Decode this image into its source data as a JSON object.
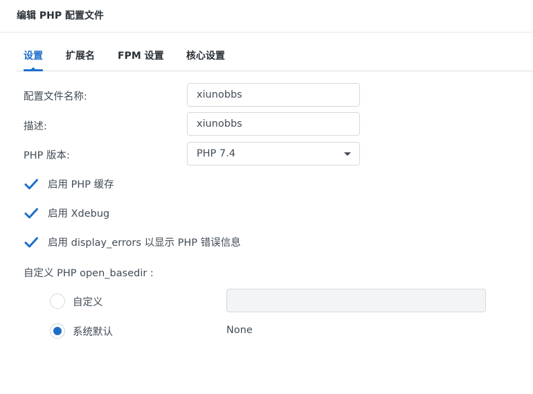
{
  "window": {
    "title": "编辑 PHP 配置文件"
  },
  "tabs": [
    {
      "label": "设置",
      "active": true
    },
    {
      "label": "扩展名",
      "active": false
    },
    {
      "label": "FPM 设置",
      "active": false
    },
    {
      "label": "核心设置",
      "active": false
    }
  ],
  "form": {
    "profile_name": {
      "label": "配置文件名称:",
      "value": "xiunobbs"
    },
    "description": {
      "label": "描述:",
      "value": "xiunobbs"
    },
    "php_version": {
      "label": "PHP 版本:",
      "value": "PHP 7.4"
    }
  },
  "checkboxes": [
    {
      "label": "启用 PHP 缓存",
      "checked": true
    },
    {
      "label": "启用 Xdebug",
      "checked": true
    },
    {
      "label": "启用 display_errors 以显示 PHP 错误信息",
      "checked": true
    }
  ],
  "open_basedir": {
    "label": "自定义 PHP open_basedir :",
    "options": [
      {
        "label": "自定义",
        "selected": false,
        "value": ""
      },
      {
        "label": "系统默认",
        "selected": true,
        "value": "None"
      }
    ]
  },
  "colors": {
    "accent": "#1e6ec9",
    "text": "#414b55",
    "border": "#d4d9de"
  }
}
